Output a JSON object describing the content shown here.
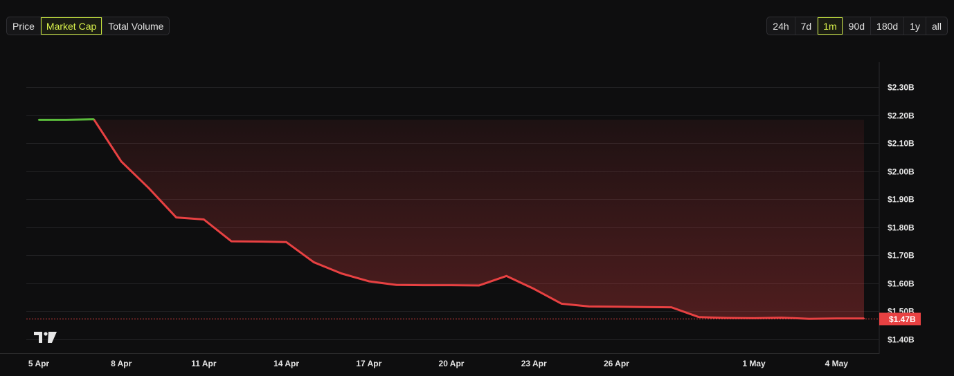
{
  "metric_tabs": [
    "Price",
    "Market Cap",
    "Total Volume"
  ],
  "metric_active": "Market Cap",
  "range_tabs": [
    "24h",
    "7d",
    "1m",
    "90d",
    "180d",
    "1y",
    "all"
  ],
  "range_active": "1m",
  "logo_text": "TV",
  "colors": {
    "down": "#e84142",
    "up": "#5bbd3c",
    "accent": "#d9f24b"
  },
  "chart_data": {
    "type": "line",
    "title": "",
    "xlabel": "",
    "ylabel": "",
    "ylim": [
      1.35,
      2.39
    ],
    "y_ticks": [
      1.4,
      1.5,
      1.6,
      1.7,
      1.8,
      1.9,
      2.0,
      2.1,
      2.2,
      2.3
    ],
    "y_tick_labels": [
      "$1.40B",
      "$1.50B",
      "$1.60B",
      "$1.70B",
      "$1.80B",
      "$1.90B",
      "$2.00B",
      "$2.10B",
      "$2.20B",
      "$2.30B"
    ],
    "x_ticks": [
      "5 Apr",
      "8 Apr",
      "11 Apr",
      "14 Apr",
      "17 Apr",
      "20 Apr",
      "23 Apr",
      "26 Apr",
      "1 May",
      "4 May"
    ],
    "x_tick_days": [
      0,
      3,
      6,
      9,
      12,
      15,
      18,
      21,
      26,
      29
    ],
    "current_label": "$1.47B",
    "current_value": 1.474,
    "grid": true,
    "series": [
      {
        "x": [
          0,
          1,
          2,
          3,
          4,
          5,
          6,
          7,
          8,
          9,
          10,
          11,
          12,
          13,
          14,
          15,
          16,
          17,
          18,
          19,
          20,
          21,
          22,
          23,
          24,
          25,
          26,
          27,
          28,
          29,
          30
        ],
        "values": [
          2.184,
          2.184,
          2.186,
          2.035,
          1.94,
          1.835,
          1.828,
          1.75,
          1.749,
          1.747,
          1.675,
          1.635,
          1.607,
          1.594,
          1.593,
          1.593,
          1.592,
          1.626,
          1.58,
          1.527,
          1.517,
          1.516,
          1.515,
          1.514,
          1.479,
          1.476,
          1.475,
          1.477,
          1.473,
          1.474,
          1.474
        ]
      }
    ]
  }
}
